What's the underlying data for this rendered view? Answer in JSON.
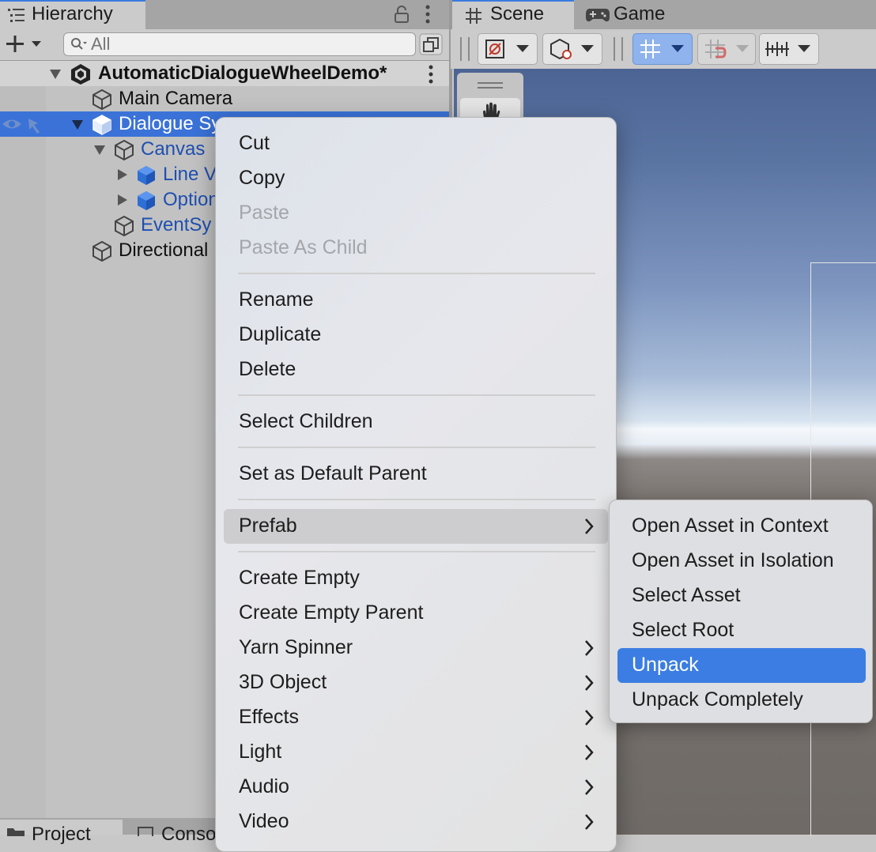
{
  "hierarchy": {
    "tab_label": "Hierarchy",
    "search_placeholder": "All",
    "scene_name": "AutomaticDialogueWheelDemo*",
    "items": [
      {
        "label": "Main Camera"
      },
      {
        "label": "Dialogue Sy"
      },
      {
        "label": "Canvas"
      },
      {
        "label": "Line V"
      },
      {
        "label": "Option"
      },
      {
        "label": "EventSy"
      },
      {
        "label": "Directional"
      }
    ],
    "bottom_tabs": {
      "project": "Project",
      "console": "Conso"
    }
  },
  "scene_view": {
    "tabs": {
      "scene": "Scene",
      "game": "Game"
    }
  },
  "context_menu": {
    "items": {
      "cut": "Cut",
      "copy": "Copy",
      "paste": "Paste",
      "paste_as_child": "Paste As Child",
      "rename": "Rename",
      "duplicate": "Duplicate",
      "delete": "Delete",
      "select_children": "Select Children",
      "set_default_parent": "Set as Default Parent",
      "prefab": "Prefab",
      "create_empty": "Create Empty",
      "create_empty_parent": "Create Empty Parent",
      "yarn_spinner": "Yarn Spinner",
      "object_3d": "3D Object",
      "effects": "Effects",
      "light": "Light",
      "audio": "Audio",
      "video": "Video"
    }
  },
  "prefab_submenu": {
    "items": {
      "open_in_context": "Open Asset in Context",
      "open_in_isolation": "Open Asset in Isolation",
      "select_asset": "Select Asset",
      "select_root": "Select Root",
      "unpack": "Unpack",
      "unpack_completely": "Unpack Completely"
    }
  },
  "colors": {
    "accent": "#3b7de2",
    "prefab_blue": "#1f4fb0"
  }
}
